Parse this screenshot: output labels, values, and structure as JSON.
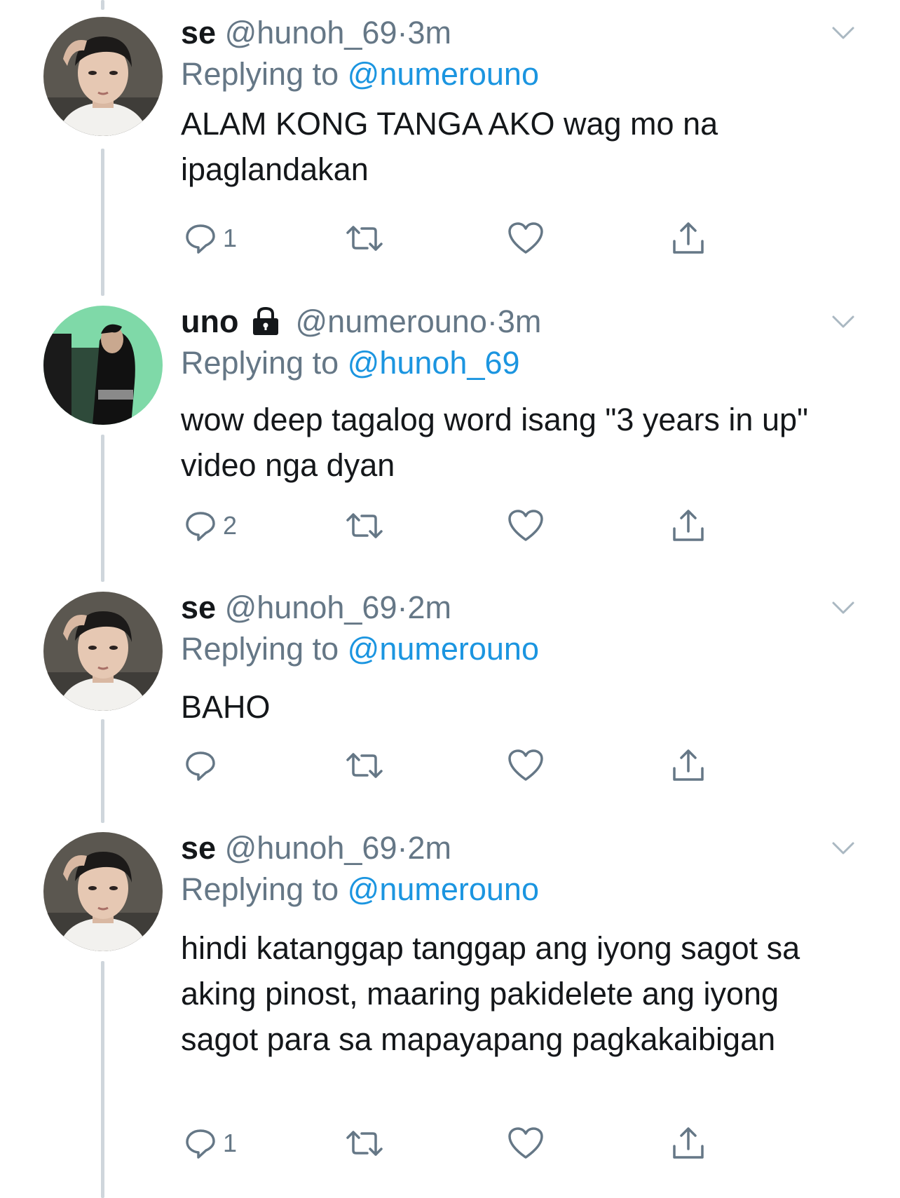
{
  "tweets": [
    {
      "display_name": "se",
      "handle": "@hunoh_69",
      "separator": "·",
      "time": "3m",
      "replying_prefix": "Replying to ",
      "replying_to": "@numerouno",
      "text": "ALAM KONG TANGA AKO wag mo na ipaglandakan",
      "reply_count": "1",
      "locked": false,
      "avatar": "se-avatar"
    },
    {
      "display_name": "uno",
      "handle": "@numerouno",
      "separator": "·",
      "time": "3m",
      "replying_prefix": "Replying to ",
      "replying_to": "@hunoh_69",
      "text": "wow deep tagalog word isang \"3 years in up\" video nga dyan",
      "reply_count": "2",
      "locked": true,
      "avatar": "uno-avatar"
    },
    {
      "display_name": "se",
      "handle": "@hunoh_69",
      "separator": "·",
      "time": "2m",
      "replying_prefix": "Replying to ",
      "replying_to": "@numerouno",
      "text": "BAHO",
      "reply_count": "",
      "locked": false,
      "avatar": "se-avatar"
    },
    {
      "display_name": "se",
      "handle": "@hunoh_69",
      "separator": "·",
      "time": "2m",
      "replying_prefix": "Replying to ",
      "replying_to": "@numerouno",
      "text": "hindi katanggap tanggap ang iyong sagot sa aking pinost, maaring pakidelete ang iyong sagot para sa mapayapang pagkakaibigan",
      "reply_count": "1",
      "locked": false,
      "avatar": "se-avatar"
    }
  ],
  "icons": {
    "reply": "reply-icon",
    "retweet": "retweet-icon",
    "like": "heart-icon",
    "share": "share-icon",
    "more": "chevron-down-icon",
    "lock": "lock-icon"
  },
  "colors": {
    "text": "#14171a",
    "secondary": "#657786",
    "link": "#1b95e0",
    "thread_line": "#cfd6dc",
    "avatar_green": "#7fd9a8"
  }
}
